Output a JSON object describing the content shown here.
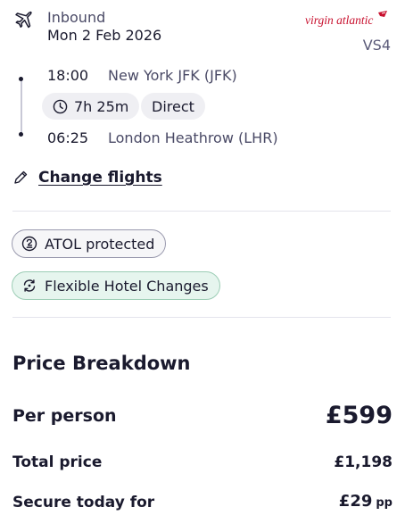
{
  "flight": {
    "direction": "Inbound",
    "date": "Mon 2 Feb 2026",
    "airline_logo_text": "virgin atlantic",
    "flight_code": "VS4",
    "departure": {
      "time": "18:00",
      "airport": "New York JFK (JFK)"
    },
    "duration": "7h 25m",
    "stops": "Direct",
    "arrival": {
      "time": "06:25",
      "airport": "London Heathrow (LHR)"
    },
    "change_label": "Change flights"
  },
  "badges": {
    "atol": "ATOL protected",
    "flexible": "Flexible Hotel Changes"
  },
  "price": {
    "heading": "Price Breakdown",
    "per_person_label": "Per person",
    "per_person_value": "£599",
    "total_label": "Total price",
    "total_value": "£1,198",
    "secure_label": "Secure today for",
    "secure_value": "£29",
    "secure_suffix": "pp"
  },
  "icons": [
    "plane-icon",
    "clock-icon",
    "pencil-icon",
    "atol-icon",
    "flexible-icon"
  ],
  "colors": {
    "brand_red": "#c8102e",
    "flex_badge_bg": "#e6f5ee",
    "pill_bg": "#efeff3"
  }
}
